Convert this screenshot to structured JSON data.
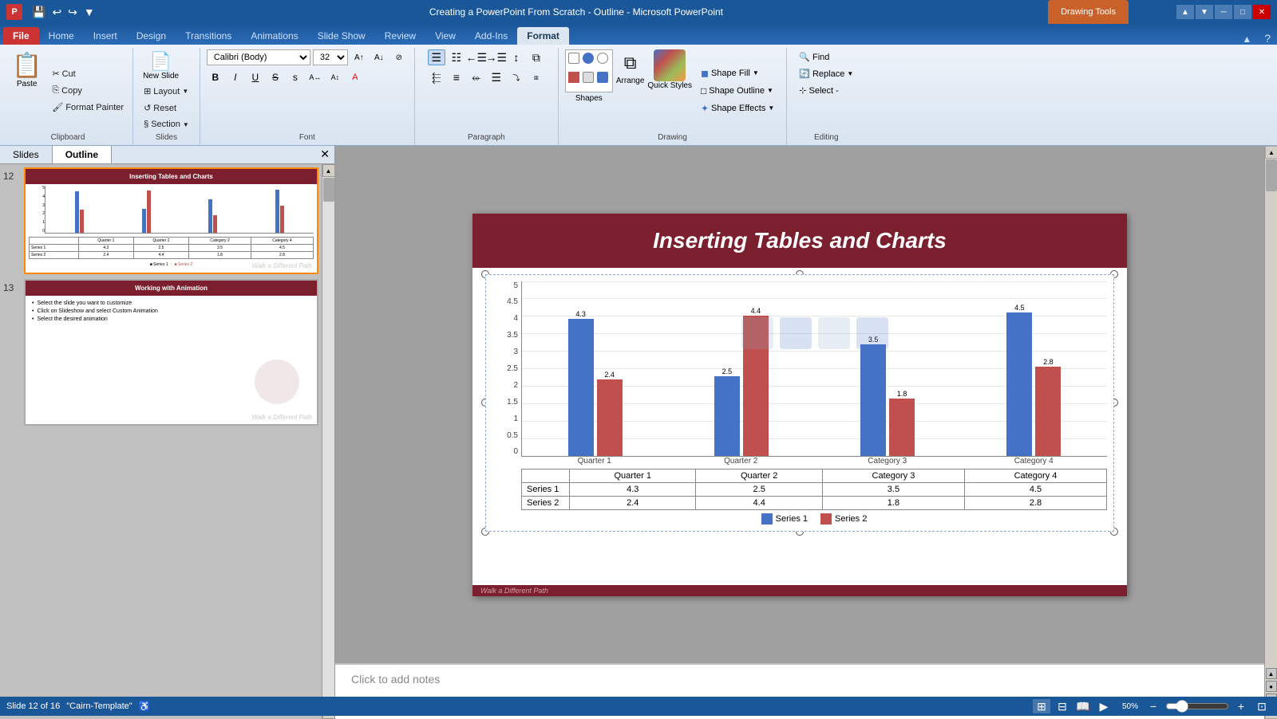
{
  "titleBar": {
    "title": "Creating a PowerPoint From Scratch - Outline - Microsoft PowerPoint",
    "drawingTools": "Drawing Tools",
    "appIcon": "P"
  },
  "ribbonTabs": [
    {
      "label": "File",
      "active": false
    },
    {
      "label": "Home",
      "active": false
    },
    {
      "label": "Insert",
      "active": false
    },
    {
      "label": "Design",
      "active": false
    },
    {
      "label": "Transitions",
      "active": false
    },
    {
      "label": "Animations",
      "active": false
    },
    {
      "label": "Slide Show",
      "active": false
    },
    {
      "label": "Review",
      "active": false
    },
    {
      "label": "View",
      "active": false
    },
    {
      "label": "Add-Ins",
      "active": false
    },
    {
      "label": "Format",
      "active": true
    }
  ],
  "clipboard": {
    "paste": "Paste",
    "cut": "Cut",
    "copy": "Copy",
    "formatPainter": "Format Painter",
    "groupLabel": "Clipboard"
  },
  "slides": {
    "newSlide": "New Slide",
    "layout": "Layout",
    "reset": "Reset",
    "section": "Section",
    "groupLabel": "Slides"
  },
  "font": {
    "fontName": "Calibri (Body)",
    "fontSize": "32",
    "bold": "B",
    "italic": "I",
    "underline": "U",
    "strikethrough": "S",
    "shadow": "s",
    "groupLabel": "Font"
  },
  "paragraph": {
    "groupLabel": "Paragraph"
  },
  "drawing": {
    "shapes": "Shapes",
    "arrange": "Arrange",
    "quickStyles": "Quick Styles",
    "shapeFill": "Shape Fill",
    "shapeOutline": "Shape Outline",
    "shapeEffects": "Shape Effects",
    "groupLabel": "Drawing"
  },
  "editing": {
    "find": "Find",
    "replace": "Replace",
    "select": "Select -",
    "groupLabel": "Editing"
  },
  "panelTabs": [
    {
      "label": "Slides",
      "active": false
    },
    {
      "label": "Outline",
      "active": true
    }
  ],
  "slides12": {
    "number": "12",
    "title": "Inserting Tables and Charts",
    "selected": true
  },
  "slides13": {
    "number": "13",
    "title": "Working with Animation",
    "bullets": [
      "Select the slide you want to customize",
      "Click on Slideshow and select Custom Animation",
      "Select the desired animation"
    ]
  },
  "mainSlide": {
    "title": "Inserting Tables and Charts",
    "footer": "Walk a Different Path"
  },
  "chart": {
    "yAxisLabels": [
      "5",
      "4.5",
      "4",
      "3.5",
      "3",
      "2.5",
      "2",
      "1.5",
      "1",
      "0.5",
      "0"
    ],
    "categories": [
      "Quarter 1",
      "Quarter 2",
      "Category 3",
      "Category 4"
    ],
    "series1": {
      "name": "Series 1",
      "values": [
        4.3,
        2.5,
        3.5,
        4.5
      ],
      "color": "#4472c4"
    },
    "series2": {
      "name": "Series 2",
      "values": [
        2.4,
        4.4,
        1.8,
        2.8
      ],
      "color": "#c0504d"
    },
    "barLabels1": [
      "4.3",
      "2.5",
      "3.5",
      "4.5"
    ],
    "barLabels2": [
      "2.4",
      "4.4",
      "1.8",
      "2.8"
    ]
  },
  "notes": {
    "placeholder": "Click to add notes"
  },
  "statusBar": {
    "slideInfo": "Slide 12 of 16",
    "theme": "\"Cairn-Template\"",
    "zoom": "50%"
  }
}
